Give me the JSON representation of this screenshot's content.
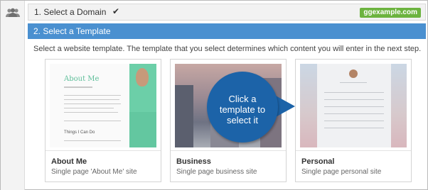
{
  "steps": {
    "step1": {
      "label": "1. Select a Domain",
      "check": "✔",
      "domain": "ggexample.com"
    },
    "step2": {
      "label": "2. Select a Template"
    }
  },
  "description": "Select a website template. The template that you select determines which content you will enter in the next step.",
  "templates": [
    {
      "name": "About Me",
      "description": "Single page 'About Me' site",
      "thumb_title": "About Me",
      "thumb_sub": "Things I Can Do"
    },
    {
      "name": "Business",
      "description": "Single page business site"
    },
    {
      "name": "Personal",
      "description": "Single page personal site"
    }
  ],
  "callout": {
    "lines": [
      "Click a",
      "template to",
      "select it"
    ]
  },
  "colors": {
    "accent": "#4a90d0",
    "badge": "#6cb33f",
    "callout": "#1c63a8"
  },
  "icons": {
    "sidebar": "users-icon",
    "step_done": "checkmark-icon"
  }
}
